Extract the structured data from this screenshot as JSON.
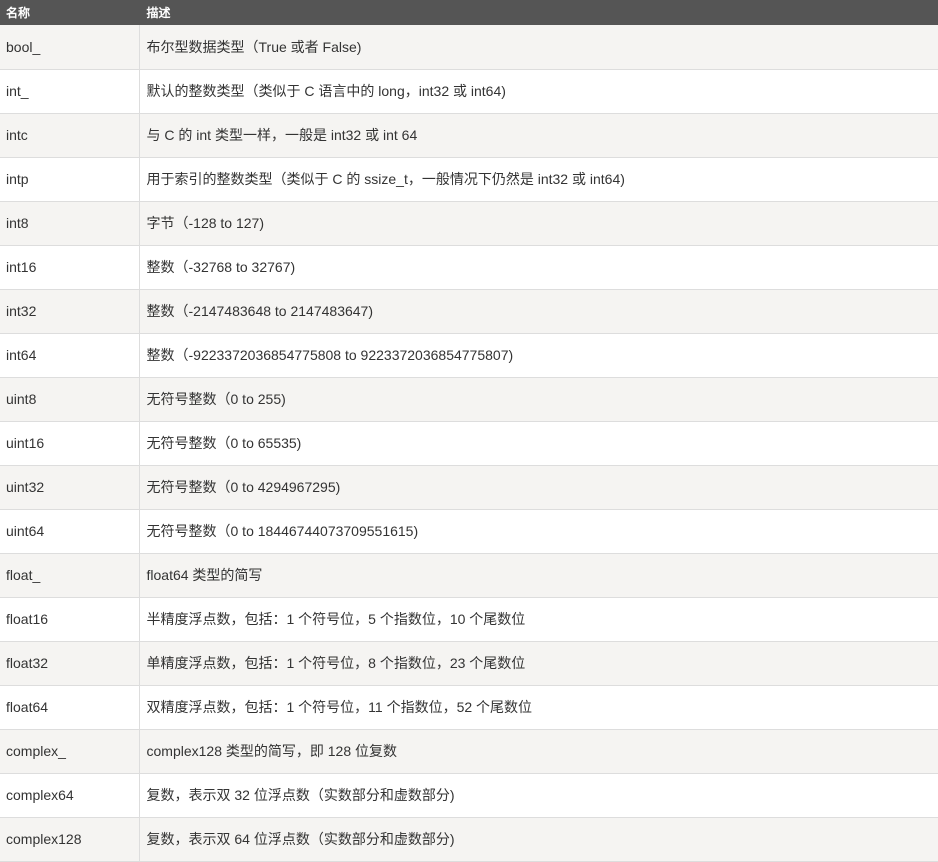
{
  "table": {
    "headers": [
      "名称",
      "描述"
    ],
    "rows": [
      {
        "name": "bool_",
        "desc": "布尔型数据类型（True 或者 False)"
      },
      {
        "name": "int_",
        "desc": "默认的整数类型（类似于 C 语言中的 long，int32 或 int64)"
      },
      {
        "name": "intc",
        "desc": "与 C 的 int 类型一样，一般是 int32 或 int 64"
      },
      {
        "name": "intp",
        "desc": "用于索引的整数类型（类似于 C 的 ssize_t，一般情况下仍然是 int32 或 int64)"
      },
      {
        "name": "int8",
        "desc": "字节（-128 to 127)"
      },
      {
        "name": "int16",
        "desc": "整数（-32768 to 32767)"
      },
      {
        "name": "int32",
        "desc": "整数（-2147483648 to 2147483647)"
      },
      {
        "name": "int64",
        "desc": "整数（-9223372036854775808 to 9223372036854775807)"
      },
      {
        "name": "uint8",
        "desc": "无符号整数（0 to 255)"
      },
      {
        "name": "uint16",
        "desc": "无符号整数（0 to 65535)"
      },
      {
        "name": "uint32",
        "desc": "无符号整数（0 to 4294967295)"
      },
      {
        "name": "uint64",
        "desc": "无符号整数（0 to 18446744073709551615)"
      },
      {
        "name": "float_",
        "desc": "float64 类型的简写"
      },
      {
        "name": "float16",
        "desc": "半精度浮点数，包括：1 个符号位，5 个指数位，10 个尾数位"
      },
      {
        "name": "float32",
        "desc": "单精度浮点数，包括：1 个符号位，8 个指数位，23 个尾数位"
      },
      {
        "name": "float64",
        "desc": "双精度浮点数，包括：1 个符号位，11 个指数位，52 个尾数位"
      },
      {
        "name": "complex_",
        "desc": "complex128 类型的简写，即 128 位复数"
      },
      {
        "name": "complex64",
        "desc": "复数，表示双 32 位浮点数（实数部分和虚数部分)"
      },
      {
        "name": "complex128",
        "desc": "复数，表示双 64 位浮点数（实数部分和虚数部分)"
      }
    ]
  }
}
